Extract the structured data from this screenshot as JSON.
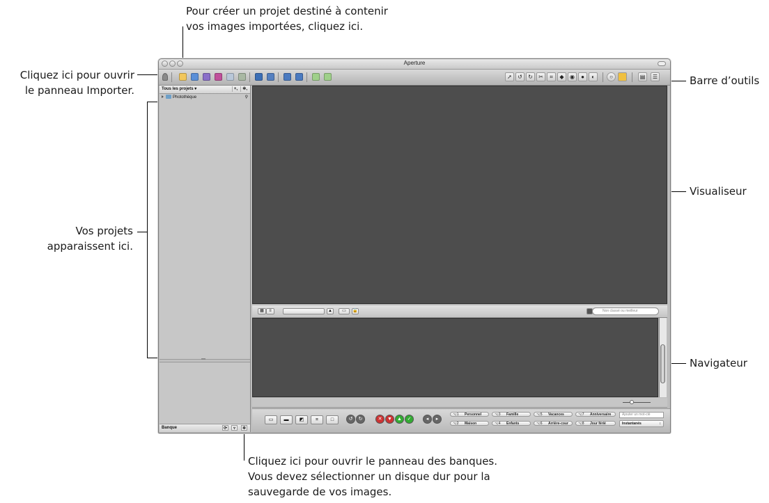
{
  "callouts": {
    "top_line1": "Pour créer un projet destiné à contenir",
    "top_line2": "vos images importées, cliquez ici.",
    "left_import_line1": "Cliquez ici pour ouvrir",
    "left_import_line2": "le panneau Importer.",
    "left_projects_line1": "Vos projets",
    "left_projects_line2": "apparaissent ici.",
    "toolbar": "Barre d’outils",
    "viewer": "Visualiseur",
    "browser": "Navigateur",
    "bottom_line1": "Cliquez ici pour ouvrir le panneau des banques.",
    "bottom_line2": "Vous devez sélectionner un disque dur pour la",
    "bottom_line3": "sauvegarde de vos images."
  },
  "window": {
    "title": "Aperture"
  },
  "projects_panel": {
    "header": "Tous les projets ▾",
    "add_button": "+,",
    "action_button": "✲,",
    "library_item": "Photothèque"
  },
  "vault_panel": {
    "label": "Banque"
  },
  "browser_bar": {
    "search_placeholder": "Non classé ou meilleur"
  },
  "keywords": {
    "row1": [
      {
        "key": "⌥1",
        "label": "Personnel"
      },
      {
        "key": "⌥3",
        "label": "Famille"
      },
      {
        "key": "⌥5",
        "label": "Vacances"
      },
      {
        "key": "⌥7",
        "label": "Anniversaire"
      }
    ],
    "row2": [
      {
        "key": "⌥2",
        "label": "Maison"
      },
      {
        "key": "⌥4",
        "label": "Enfants"
      },
      {
        "key": "⌥6",
        "label": "Arrière-cour"
      },
      {
        "key": "⌥8",
        "label": "Jour férié"
      }
    ],
    "add_placeholder": "Ajouter un mot-clé",
    "preset_selected": "Instantanés"
  },
  "colors": {
    "viewer_bg": "#4d4d4d",
    "panel_bg": "#c7c7c7"
  }
}
